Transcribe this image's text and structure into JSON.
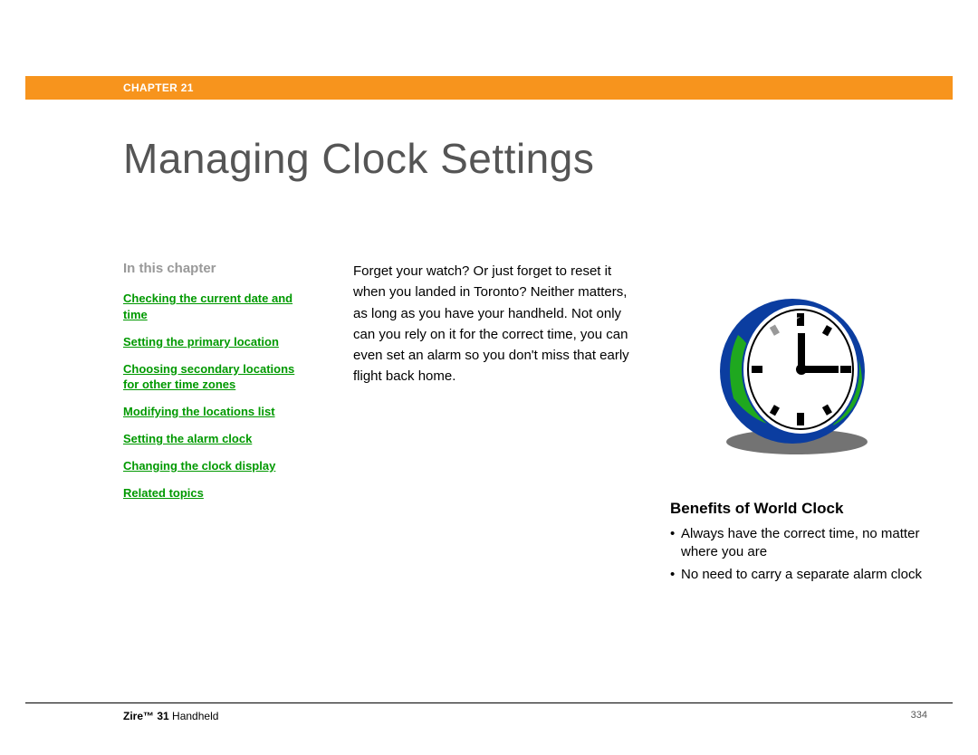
{
  "header": {
    "chapter_label": "CHAPTER 21"
  },
  "title": "Managing Clock Settings",
  "sidebar": {
    "heading": "In this chapter",
    "items": [
      "Checking the current date and time",
      "Setting the primary location",
      "Choosing secondary locations for other time zones",
      "Modifying the locations list",
      "Setting the alarm clock",
      "Changing the clock display",
      "Related topics"
    ]
  },
  "intro": "Forget your watch? Or just forget to reset it when you landed in Toronto? Neither matters, as long as you have your handheld. Not only can you rely on it for the correct time, you can even set an alarm so you don't miss that early flight back home.",
  "benefits": {
    "heading": "Benefits of World Clock",
    "items": [
      "Always have the correct time, no matter where you are",
      "No need to carry a separate alarm clock"
    ]
  },
  "footer": {
    "product_bold": "Zire™ 31",
    "product_rest": " Handheld",
    "page_number": "334"
  }
}
